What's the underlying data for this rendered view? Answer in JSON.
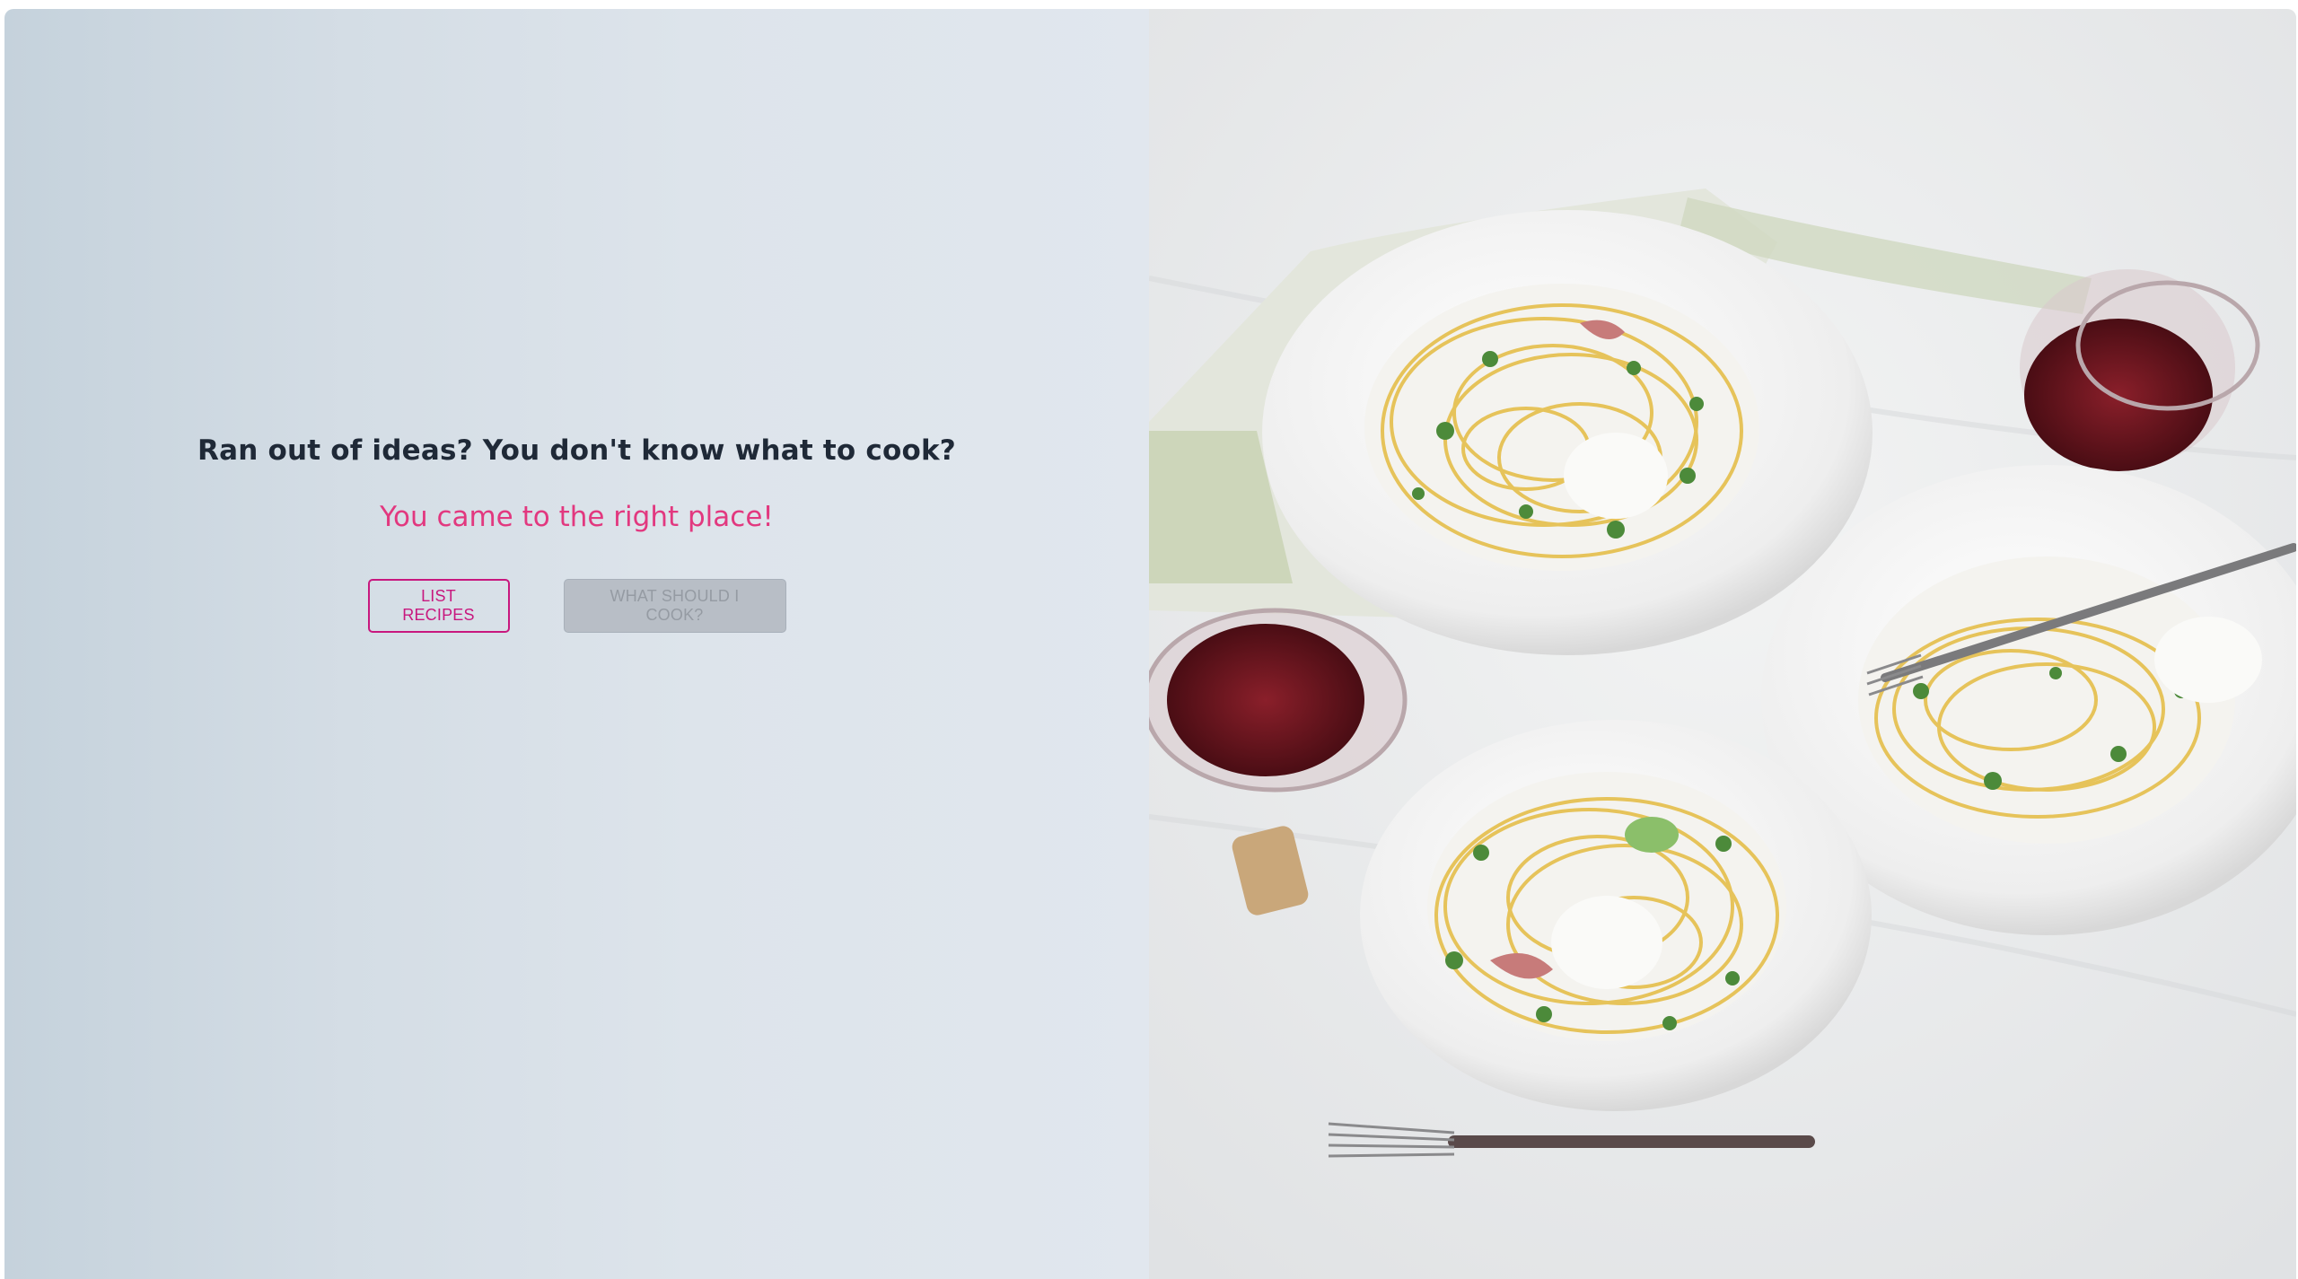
{
  "hero": {
    "headline": "Ran out of ideas? You don't know what to cook?",
    "subheadline": "You came to the right place!"
  },
  "actions": {
    "list_recipes_label": "LIST RECIPES",
    "what_to_cook_label": "WHAT SHOULD I COOK?"
  },
  "image": {
    "description_icon": "pasta-dinner-photo"
  },
  "colors": {
    "accent": "#e2387f",
    "primary_button": "#c8177e",
    "headline": "#1f2937",
    "panel_bg": "#d8e0e7"
  }
}
